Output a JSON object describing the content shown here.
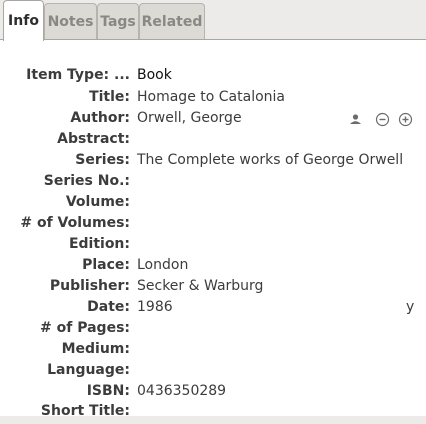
{
  "tabs": {
    "info": "Info",
    "notes": "Notes",
    "tags": "Tags",
    "related": "Related"
  },
  "fields": {
    "item_type": {
      "label": "Item Type: ...",
      "value": "Book"
    },
    "title": {
      "label": "Title:",
      "value": "Homage to Catalonia"
    },
    "author": {
      "label": "Author:",
      "value": "Orwell, George"
    },
    "abstract": {
      "label": "Abstract:",
      "value": ""
    },
    "series": {
      "label": "Series:",
      "value": "The Complete works of George Orwell"
    },
    "series_no": {
      "label": "Series No.:",
      "value": ""
    },
    "volume": {
      "label": "Volume:",
      "value": ""
    },
    "num_volumes": {
      "label": "# of Volumes:",
      "value": ""
    },
    "edition": {
      "label": "Edition:",
      "value": ""
    },
    "place": {
      "label": "Place:",
      "value": "London"
    },
    "publisher": {
      "label": "Publisher:",
      "value": "Secker & Warburg"
    },
    "date": {
      "label": "Date:",
      "value": "1986",
      "extra": "y"
    },
    "num_pages": {
      "label": "# of Pages:",
      "value": ""
    },
    "medium": {
      "label": "Medium:",
      "value": ""
    },
    "language": {
      "label": "Language:",
      "value": ""
    },
    "isbn": {
      "label": "ISBN:",
      "value": "0436350289"
    },
    "short_title": {
      "label": "Short Title:",
      "value": ""
    }
  },
  "icons": {
    "author_type": "person-icon",
    "remove_author": "minus-circle-icon",
    "add_author": "plus-circle-icon"
  }
}
